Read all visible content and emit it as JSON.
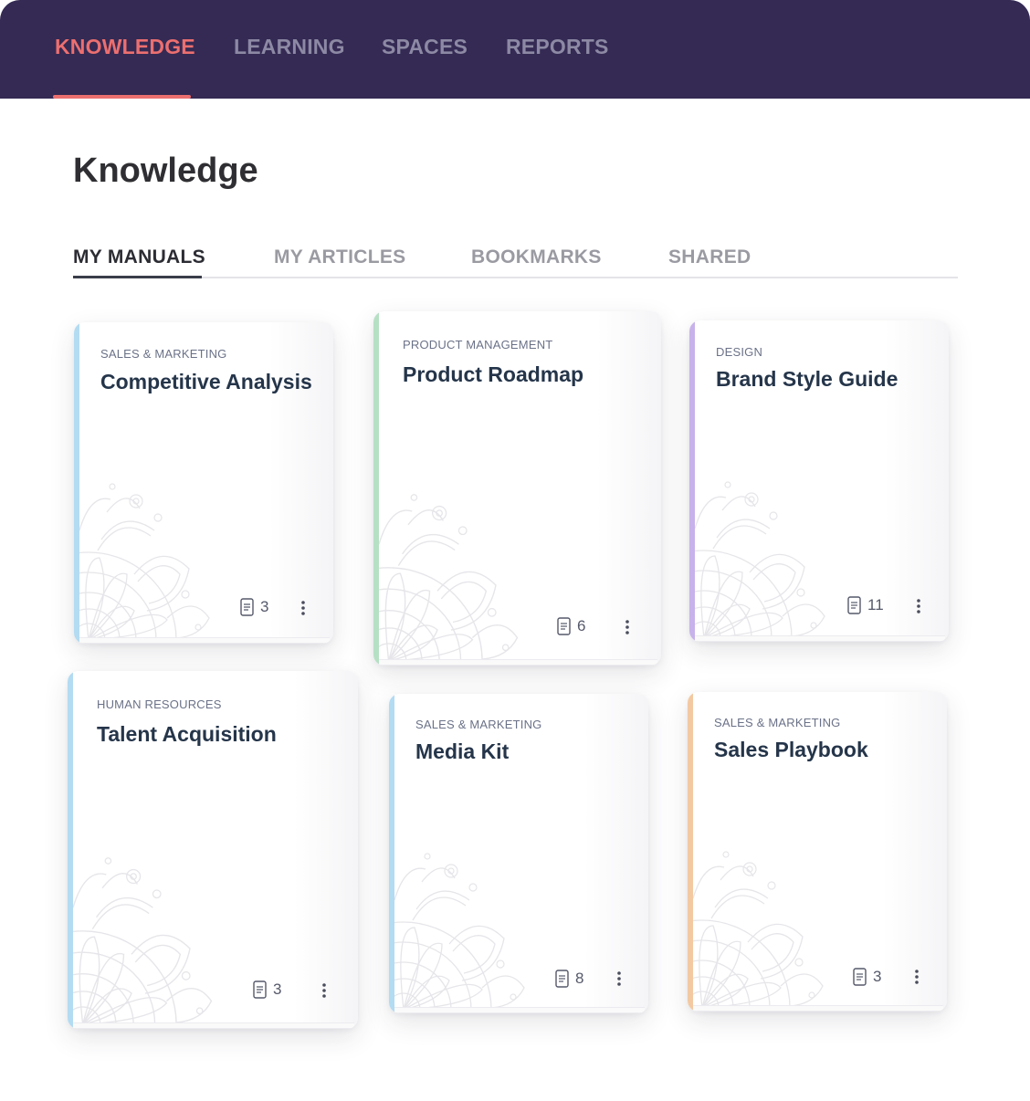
{
  "top_nav": {
    "items": [
      {
        "label": "KNOWLEDGE",
        "active": true
      },
      {
        "label": "LEARNING",
        "active": false
      },
      {
        "label": "SPACES",
        "active": false
      },
      {
        "label": "REPORTS",
        "active": false
      }
    ]
  },
  "page": {
    "title": "Knowledge"
  },
  "subtabs": {
    "items": [
      {
        "label": "MY MANUALS",
        "active": true
      },
      {
        "label": "MY ARTICLES",
        "active": false
      },
      {
        "label": "BOOKMARKS",
        "active": false
      },
      {
        "label": "SHARED",
        "active": false
      }
    ]
  },
  "manuals": [
    {
      "category": "SALES & MARKETING",
      "title": "Competitive Analysis",
      "count": "3",
      "spine_color": "#b3dbf2"
    },
    {
      "category": "PRODUCT MANAGEMENT",
      "title": "Product Roadmap",
      "count": "6",
      "spine_color": "#b6e0c4"
    },
    {
      "category": "DESIGN",
      "title": "Brand Style Guide",
      "count": "11",
      "spine_color": "#c8b2ea"
    },
    {
      "category": "HUMAN RESOURCES",
      "title": "Talent Acquisition",
      "count": "3",
      "spine_color": "#b3dbf2"
    },
    {
      "category": "SALES & MARKETING",
      "title": "Media Kit",
      "count": "8",
      "spine_color": "#b3dbf2"
    },
    {
      "category": "SALES & MARKETING",
      "title": "Sales Playbook",
      "count": "3",
      "spine_color": "#f3c9a2"
    }
  ],
  "colors": {
    "topbar_bg": "#342a54",
    "accent": "#ec6f6f",
    "title_text": "#25354a"
  },
  "icons": {
    "count": "document-icon",
    "menu": "more-vertical-icon",
    "decoration": "mandala-pattern"
  }
}
